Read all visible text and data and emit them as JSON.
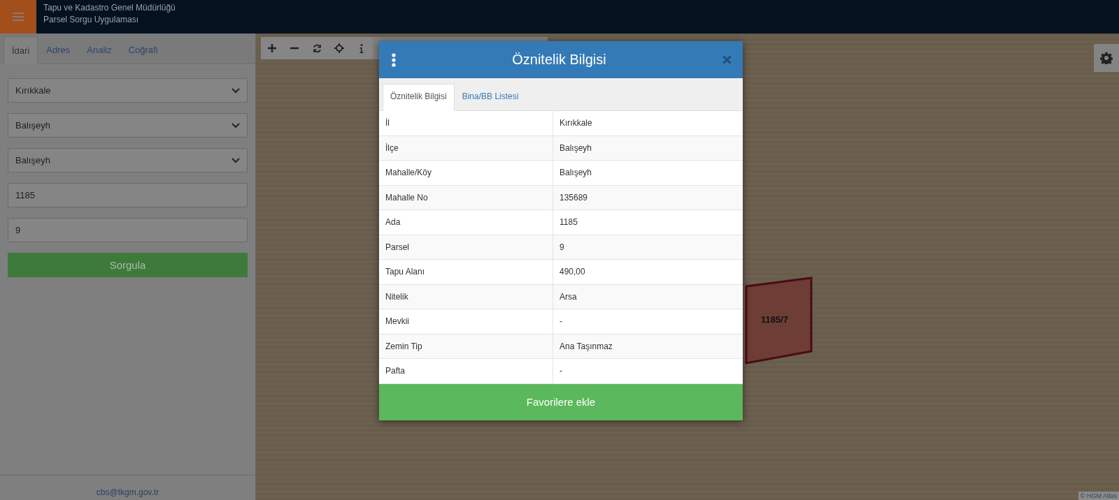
{
  "header": {
    "title": "Tapu ve Kadastro Genel Müdürlüğü",
    "subtitle": "Parsel Sorgu Uygulaması"
  },
  "sidebar": {
    "tabs": [
      {
        "label": "İdari",
        "selected": true
      },
      {
        "label": "Adres",
        "selected": false
      },
      {
        "label": "Analiz",
        "selected": false
      },
      {
        "label": "Coğrafi",
        "selected": false
      }
    ],
    "selects": [
      "Kırıkkale",
      "Balışeyh",
      "Balışeyh"
    ],
    "inputs": [
      "1185",
      "9"
    ],
    "button": "Sorgula",
    "footer_email": "cbs@tkgm.gov.tr"
  },
  "map": {
    "parcel_label": "1185/7",
    "attribution": "© HGM Atlas"
  },
  "modal": {
    "title": "Öznitelik Bilgisi",
    "tabs": [
      {
        "label": "Öznitelik Bilgisi",
        "selected": true
      },
      {
        "label": "Bina/BB Listesi",
        "selected": false
      }
    ],
    "rows": [
      {
        "label": "İl",
        "value": "Kırıkkale"
      },
      {
        "label": "İlçe",
        "value": "Balışeyh"
      },
      {
        "label": "Mahalle/Köy",
        "value": "Balışeyh"
      },
      {
        "label": "Mahalle No",
        "value": "135689"
      },
      {
        "label": "Ada",
        "value": "1185"
      },
      {
        "label": "Parsel",
        "value": "9"
      },
      {
        "label": "Tapu Alanı",
        "value": "490,00"
      },
      {
        "label": "Nitelik",
        "value": "Arsa"
      },
      {
        "label": "Mevkii",
        "value": "-"
      },
      {
        "label": "Zemin Tip",
        "value": "Ana Taşınmaz"
      },
      {
        "label": "Pafta",
        "value": "-"
      }
    ],
    "button": "Favorilere ekle"
  }
}
